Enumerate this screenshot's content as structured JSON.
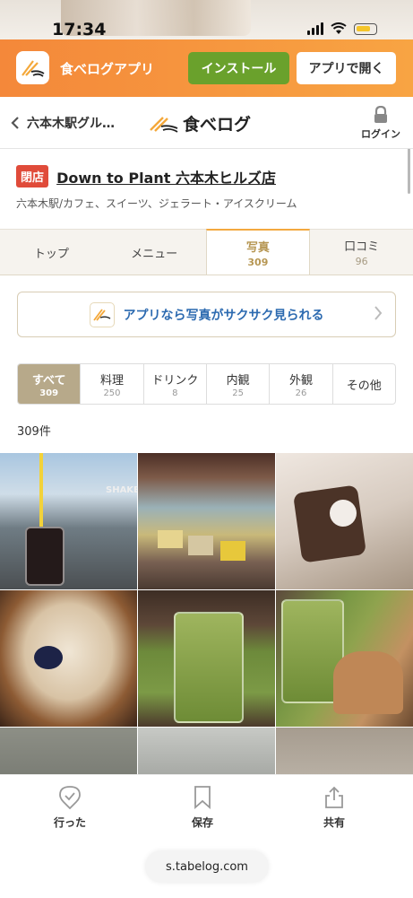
{
  "status_bar": {
    "time": "17:34"
  },
  "banner": {
    "app_name": "食べログアプリ",
    "install_label": "インストール",
    "open_label": "アプリで開く"
  },
  "nav": {
    "back_label": "六本木駅グル…",
    "brand": "食べログ",
    "login_label": "ログイン"
  },
  "restaurant": {
    "status_badge": "閉店",
    "name": "Down to Plant 六本木ヒルズ店",
    "genre": "六本木駅/カフェ、スイーツ、ジェラート・アイスクリーム"
  },
  "tabs": [
    {
      "label": "トップ",
      "count": ""
    },
    {
      "label": "メニュー",
      "count": ""
    },
    {
      "label": "写真",
      "count": "309"
    },
    {
      "label": "口コミ",
      "count": "96"
    }
  ],
  "promo": {
    "text": "アプリなら写真がサクサク見られる"
  },
  "filters": [
    {
      "label": "すべて",
      "count": "309"
    },
    {
      "label": "料理",
      "count": "250"
    },
    {
      "label": "ドリンク",
      "count": "8"
    },
    {
      "label": "内観",
      "count": "25"
    },
    {
      "label": "外観",
      "count": "26"
    },
    {
      "label": "その他",
      "count": ""
    }
  ],
  "total_label": "309件",
  "photos": [
    {
      "text": "SHAKE"
    }
  ],
  "bottom_actions": {
    "went": "行った",
    "save": "保存",
    "share": "共有"
  },
  "browser": {
    "url": "s.tabelog.com"
  },
  "colors": {
    "banner_orange": "#f4883a",
    "install_green": "#6aa12c",
    "closed_red": "#e04b3a",
    "tab_accent": "#f3a93f",
    "chip_active": "#b7a98a",
    "link_blue": "#2c6ab0"
  }
}
